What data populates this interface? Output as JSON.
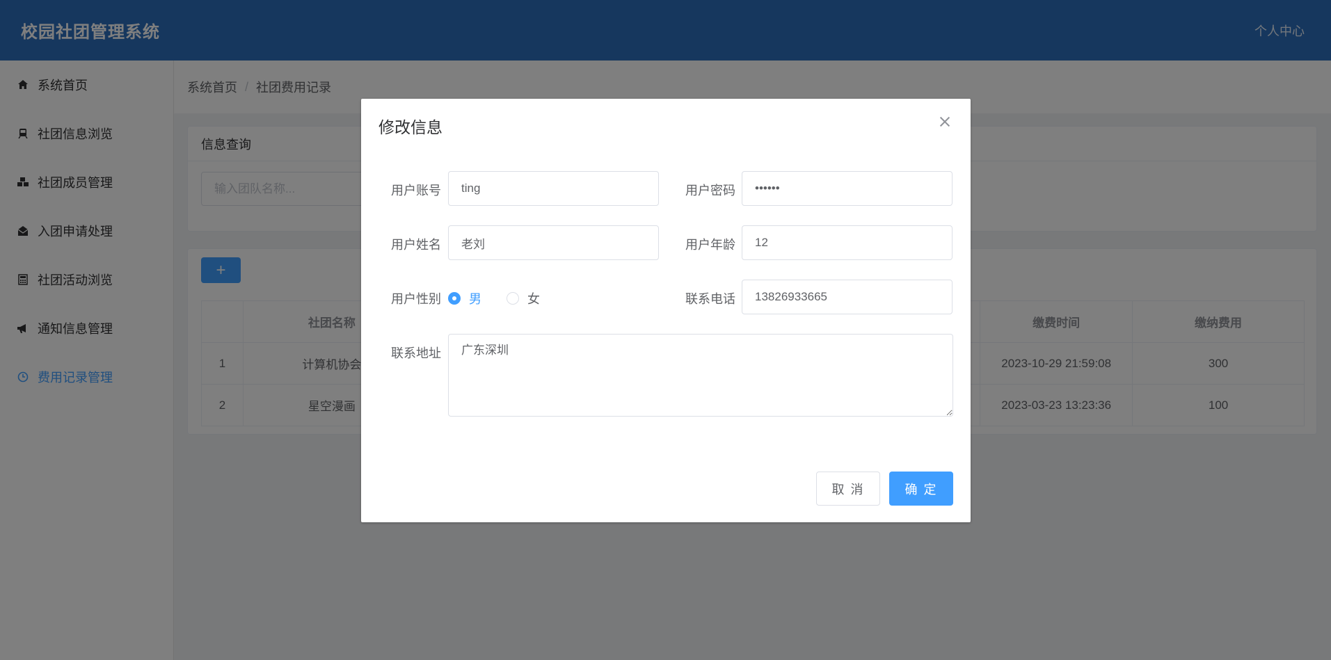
{
  "header": {
    "brand": "校园社团管理系统",
    "user_center": "个人中心"
  },
  "sidebar": {
    "items": [
      {
        "label": "系统首页",
        "icon": "home-icon",
        "active": false
      },
      {
        "label": "社团信息浏览",
        "icon": "train-icon",
        "active": false
      },
      {
        "label": "社团成员管理",
        "icon": "cubes-icon",
        "active": false
      },
      {
        "label": "入团申请处理",
        "icon": "envelope-open-icon",
        "active": false
      },
      {
        "label": "社团活动浏览",
        "icon": "calculator-icon",
        "active": false
      },
      {
        "label": "通知信息管理",
        "icon": "bullhorn-icon",
        "active": false
      },
      {
        "label": "费用记录管理",
        "icon": "clock-icon",
        "active": true
      }
    ]
  },
  "breadcrumb": {
    "home": "系统首页",
    "separator": "/",
    "current": "社团费用记录"
  },
  "search": {
    "title": "信息查询",
    "placeholder": "输入团队名称..."
  },
  "toolbar": {
    "add_label": "+"
  },
  "table": {
    "columns": [
      "",
      "社团名称",
      "缴费时间",
      "缴纳费用"
    ],
    "rows": [
      {
        "index": "1",
        "club": "计算机协会",
        "time": "2023-10-29 21:59:08",
        "fee": "300"
      },
      {
        "index": "2",
        "club": "星空漫画",
        "time": "2023-03-23 13:23:36",
        "fee": "100"
      }
    ]
  },
  "dialog": {
    "title": "修改信息",
    "fields": {
      "account_label": "用户账号",
      "account_value": "ting",
      "password_label": "用户密码",
      "password_value": "••••••",
      "name_label": "用户姓名",
      "name_value": "老刘",
      "age_label": "用户年龄",
      "age_value": "12",
      "gender_label": "用户性别",
      "gender_male": "男",
      "gender_female": "女",
      "gender_selected": "男",
      "phone_label": "联系电话",
      "phone_value": "13826933665",
      "address_label": "联系地址",
      "address_value": "广东深圳"
    },
    "cancel_label": "取 消",
    "ok_label": "确 定"
  },
  "colors": {
    "header": "#2d6fbd",
    "primary": "#409eff",
    "overlay": "rgba(0,0,0,0.5)"
  }
}
